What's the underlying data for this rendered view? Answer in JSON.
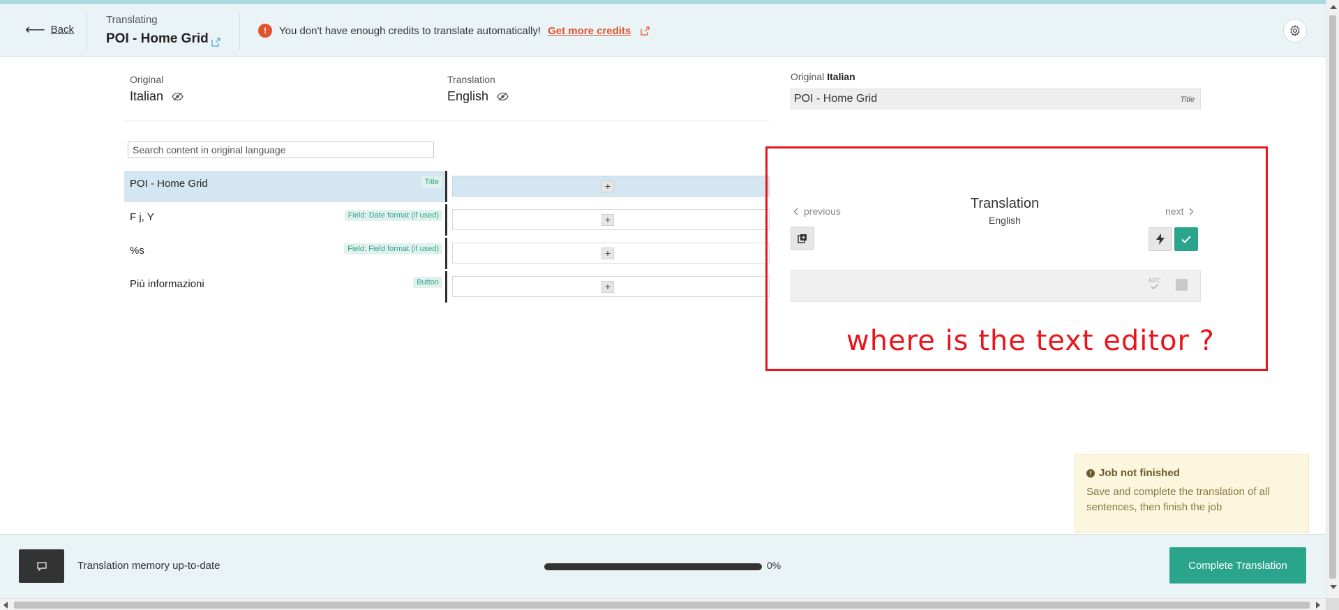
{
  "header": {
    "back_label": "Back",
    "translating_label": "Translating",
    "job_title": "POI - Home Grid",
    "alert_text": "You don't have enough credits to translate automatically!",
    "alert_link": "Get more credits"
  },
  "languages": {
    "original_label": "Original",
    "original_name": "Italian",
    "translation_label": "Translation",
    "translation_name": "English"
  },
  "search": {
    "placeholder": "Search content in original language"
  },
  "rows": [
    {
      "source": "POI - Home Grid",
      "tag": "Title",
      "active": true
    },
    {
      "source": "F j, Y",
      "tag": "Field: Date format (if used)"
    },
    {
      "source": "%s",
      "tag": "Field: Field format (if used)"
    },
    {
      "source": "Più informazioni",
      "tag": "Button"
    }
  ],
  "detail": {
    "original_label": "Original",
    "original_lang": "Italian",
    "original_text": "POI - Home Grid",
    "original_tag": "Title",
    "prev_label": "previous",
    "next_label": "next",
    "translation_title": "Translation",
    "translation_lang": "English",
    "spell_label": "ABC"
  },
  "annotation": "where is the text editor ?",
  "job_status": {
    "title": "Job not finished",
    "description": "Save and complete the translation of all sentences, then finish the job"
  },
  "footer": {
    "tm_status": "Translation memory up-to-date",
    "progress_value": 0,
    "progress_label": "0%",
    "complete_label": "Complete Translation"
  },
  "colors": {
    "accent": "#2aa58b",
    "alert": "#e0532f",
    "annotation": "#e8151b"
  }
}
